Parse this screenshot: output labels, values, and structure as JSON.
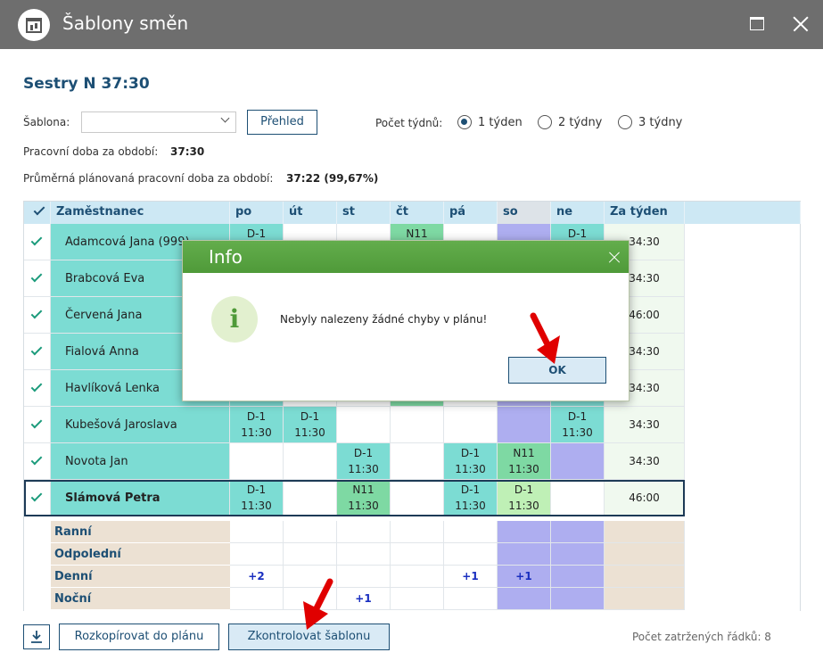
{
  "window": {
    "title": "Šablony směn"
  },
  "heading": "Sestry N 37:30",
  "template_label": "Šablona:",
  "template_value": "",
  "overview_button": "Přehled",
  "weeks_label": "Počet týdnů:",
  "week_options": [
    {
      "label": "1 týden",
      "checked": true
    },
    {
      "label": "2 týdny",
      "checked": false
    },
    {
      "label": "3 týdny",
      "checked": false
    }
  ],
  "work_time_label": "Pracovní doba za období:",
  "work_time_value": "37:30",
  "avg_time_label": "Průměrná plánovaná pracovní doba za období:",
  "avg_time_value": "37:22 (99,67%)",
  "table": {
    "headers": [
      "Zaměstnanec",
      "po",
      "út",
      "st",
      "čt",
      "pá",
      "so",
      "ne",
      "Za týden"
    ],
    "rows": [
      {
        "name": "Adamcová Jana (999)",
        "week": "34:30",
        "cells": [
          [
            "D-1",
            ""
          ],
          [
            "",
            ""
          ],
          [
            "",
            ""
          ],
          [
            "N11",
            ""
          ],
          [
            "",
            ""
          ],
          [
            "",
            ""
          ],
          [
            "D-1",
            ""
          ]
        ]
      },
      {
        "name": "Brabcová Eva",
        "week": "34:30",
        "cells": [
          [
            "",
            ""
          ],
          [
            "",
            ""
          ],
          [
            "",
            ""
          ],
          [
            "",
            ""
          ],
          [
            "",
            ""
          ],
          [
            "",
            ""
          ],
          [
            "",
            ""
          ]
        ]
      },
      {
        "name": "Červená Jana",
        "week": "46:00",
        "cells": [
          [
            "",
            ""
          ],
          [
            "",
            ""
          ],
          [
            "",
            ""
          ],
          [
            "",
            ""
          ],
          [
            "",
            ""
          ],
          [
            "",
            ""
          ],
          [
            "",
            ""
          ]
        ]
      },
      {
        "name": "Fialová Anna",
        "week": "34:30",
        "cells": [
          [
            "",
            ""
          ],
          [
            "",
            ""
          ],
          [
            "",
            ""
          ],
          [
            "",
            ""
          ],
          [
            "",
            ""
          ],
          [
            "",
            ""
          ],
          [
            "",
            ""
          ]
        ]
      },
      {
        "name": "Havlíková Lenka",
        "week": "34:30",
        "cells": [
          [
            "",
            ""
          ],
          [
            "",
            ""
          ],
          [
            "",
            ""
          ],
          [
            "",
            ""
          ],
          [
            "",
            ""
          ],
          [
            "",
            ""
          ],
          [
            "",
            ""
          ]
        ]
      },
      {
        "name": "Kubešová Jaroslava",
        "week": "34:30",
        "cells": [
          [
            "D-1",
            "11:30"
          ],
          [
            "D-1",
            "11:30"
          ],
          [
            "",
            ""
          ],
          [
            "",
            ""
          ],
          [
            "",
            ""
          ],
          [
            "",
            ""
          ],
          [
            "D-1",
            "11:30"
          ]
        ]
      },
      {
        "name": "Novota Jan",
        "week": "34:30",
        "cells": [
          [
            "",
            ""
          ],
          [
            "",
            ""
          ],
          [
            "D-1",
            "11:30"
          ],
          [
            "",
            ""
          ],
          [
            "D-1",
            "11:30"
          ],
          [
            "N11",
            "11:30"
          ],
          [
            "",
            ""
          ]
        ]
      },
      {
        "name": "Slámová Petra",
        "week": "46:00",
        "cells": [
          [
            "D-1",
            "11:30"
          ],
          [
            "",
            ""
          ],
          [
            "N11",
            "11:30"
          ],
          [
            "",
            ""
          ],
          [
            "D-1",
            "11:30"
          ],
          [
            "D-1",
            "11:30"
          ],
          [
            "",
            ""
          ]
        ]
      }
    ],
    "summary": [
      {
        "label": "Ranní",
        "values": [
          "",
          "",
          "",
          "",
          "",
          "",
          ""
        ]
      },
      {
        "label": "Odpolední",
        "values": [
          "",
          "",
          "",
          "",
          "",
          "",
          ""
        ]
      },
      {
        "label": "Denní",
        "values": [
          "+2",
          "",
          "",
          "",
          "+1",
          "+1",
          ""
        ]
      },
      {
        "label": "Noční",
        "values": [
          "",
          "",
          "+1",
          "",
          "",
          "",
          ""
        ]
      }
    ]
  },
  "buttons": {
    "copy": "Rozkopírovat do plánu",
    "check": "Zkontrolovat šablonu"
  },
  "checked_rows": "Počet zatržených řádků: 8",
  "dialog": {
    "title": "Info",
    "message": "Nebyly nalezeny žádné chyby v plánu!",
    "ok": "OK"
  },
  "colors": {
    "titlebar": "#6e6e6e",
    "accent": "#1d4f74",
    "dialog_header": "#5aa444",
    "shift_teal": "#7cdcd3",
    "weekend_blue": "#aeaef0"
  }
}
